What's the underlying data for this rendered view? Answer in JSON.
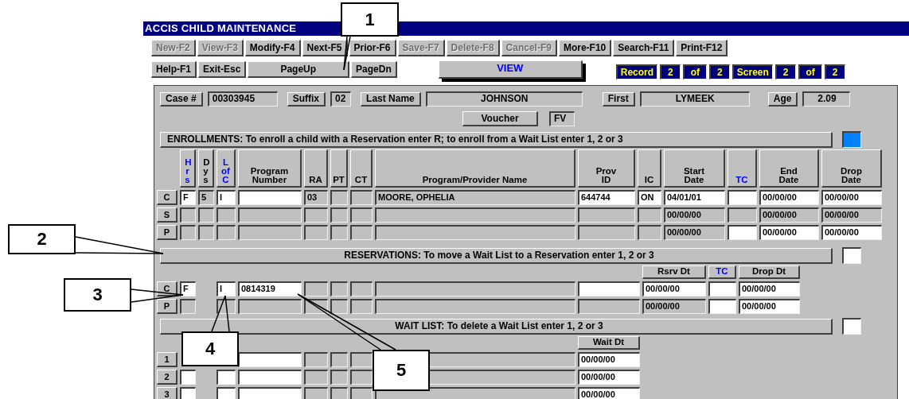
{
  "window": {
    "title": "ACCIS CHILD MAINTENANCE"
  },
  "toolbar_rows": [
    [
      {
        "label": "New-F2",
        "disabled": true
      },
      {
        "label": "View-F3",
        "disabled": true
      },
      {
        "label": "Modify-F4",
        "disabled": false
      },
      {
        "label": "Next-F5",
        "disabled": false
      },
      {
        "label": "Prior-F6",
        "disabled": false
      },
      {
        "label": "Save-F7",
        "disabled": true
      },
      {
        "label": "Delete-F8",
        "disabled": true
      },
      {
        "label": "Cancel-F9",
        "disabled": true
      },
      {
        "label": "More-F10",
        "disabled": false
      },
      {
        "label": "Search-F11",
        "disabled": false
      },
      {
        "label": "Print-F12",
        "disabled": false
      }
    ],
    [
      {
        "label": "Help-F1",
        "disabled": false
      },
      {
        "label": "Exit-Esc",
        "disabled": false
      },
      {
        "label": "PageUp",
        "disabled": false
      },
      {
        "label": "PageDn",
        "disabled": false
      }
    ]
  ],
  "mode": "VIEW",
  "pager": [
    "Record",
    "2",
    "of",
    "2",
    "Screen",
    "2",
    "of",
    "2"
  ],
  "child": {
    "fields": [
      {
        "label": "Case #",
        "value": "00303945"
      },
      {
        "label": "Suffix",
        "value": "02"
      },
      {
        "label": "Last Name",
        "value": "JOHNSON"
      },
      {
        "label": "First",
        "value": "LYMEEK"
      },
      {
        "label": "Age",
        "value": "2.09"
      }
    ],
    "voucher": {
      "label": "Voucher",
      "value": "FV"
    }
  },
  "sections": [
    {
      "kind": "enrollments",
      "title": "ENROLLMENTS: To enroll a child with a Reservation enter R;  to enroll from a Wait List enter 1, 2 or 3",
      "focused": true,
      "headers": [
        {
          "text": "Hrs",
          "kind": "vertical",
          "color": "#0000ff"
        },
        {
          "text": "Dys",
          "kind": "vertical",
          "color": "#000000"
        },
        {
          "text": "L of C",
          "kind": "stacked",
          "color": "#0000ff"
        },
        {
          "text": "Program Number",
          "kind": "stacked",
          "color": "#000000"
        },
        {
          "text": "RA",
          "kind": "stacked",
          "color": "#000000"
        },
        {
          "text": "PT",
          "kind": "stacked",
          "color": "#000000"
        },
        {
          "text": "CT",
          "kind": "stacked",
          "color": "#000000"
        },
        {
          "text": "Program/Provider Name",
          "kind": "normal",
          "color": "#000000"
        },
        {
          "text": "Prov ID",
          "kind": "stacked",
          "color": "#000000"
        },
        {
          "text": "IC",
          "kind": "stacked",
          "color": "#000000"
        },
        {
          "text": "Start Date",
          "kind": "stacked",
          "color": "#000000"
        },
        {
          "text": "TC",
          "kind": "stacked",
          "color": "#0000ff"
        },
        {
          "text": "End Date",
          "kind": "stacked",
          "color": "#000000"
        },
        {
          "text": "Drop Date",
          "kind": "stacked",
          "color": "#000000"
        }
      ],
      "rows": [
        {
          "label": "C",
          "cells": [
            {
              "value": "F",
              "editable": true
            },
            {
              "value": "5",
              "editable": false
            },
            {
              "value": "I",
              "editable": true
            },
            {
              "editable": true
            },
            {
              "value": "03",
              "editable": false
            },
            {
              "editable": false
            },
            {
              "editable": false
            },
            {
              "value": "MOORE, OPHELIA",
              "editable": false
            },
            {
              "value": "644744",
              "editable": true
            },
            {
              "value": "ON",
              "editable": true
            },
            {
              "value": "04/01/01",
              "editable": true
            },
            {
              "editable": true
            },
            {
              "value": "00/00/00",
              "editable": true
            },
            {
              "value": "00/00/00",
              "editable": true
            }
          ]
        },
        {
          "label": "S",
          "cells": [
            {
              "editable": false
            },
            {
              "editable": false
            },
            {
              "editable": false
            },
            {
              "editable": false
            },
            {
              "editable": false
            },
            {
              "editable": false
            },
            {
              "editable": false
            },
            {
              "editable": false
            },
            {
              "editable": false
            },
            {
              "editable": false
            },
            {
              "value": "00/00/00",
              "editable": false
            },
            {
              "editable": false
            },
            {
              "value": "00/00/00",
              "editable": false
            },
            {
              "value": "00/00/00",
              "editable": false
            }
          ]
        },
        {
          "label": "P",
          "cells": [
            {
              "editable": false
            },
            {
              "editable": false
            },
            {
              "editable": false
            },
            {
              "editable": false
            },
            {
              "editable": false
            },
            {
              "editable": false
            },
            {
              "editable": false
            },
            {
              "editable": false
            },
            {
              "editable": false
            },
            {
              "editable": false
            },
            {
              "value": "00/00/00",
              "editable": false
            },
            {
              "editable": true
            },
            {
              "value": "00/00/00",
              "editable": true
            },
            {
              "value": "00/00/00",
              "editable": true
            }
          ]
        }
      ]
    },
    {
      "kind": "reservations",
      "title": "RESERVATIONS: To move a Wait List to a Reservation enter 1, 2 or 3",
      "focused": false,
      "headers": [
        {
          "text": "Rsrv Dt",
          "kind": "normal",
          "color": "#000000"
        },
        {
          "text": "TC",
          "kind": "normal",
          "color": "#0000ff"
        },
        {
          "text": "Drop Dt",
          "kind": "normal",
          "color": "#000000"
        }
      ],
      "rows": [
        {
          "label": "C",
          "cells": [
            {
              "value": "F",
              "editable": true
            },
            {
              "value": "I",
              "editable": true
            },
            {
              "value": "0814319",
              "editable": true
            },
            {
              "editable": false
            },
            {
              "editable": false
            },
            {
              "editable": false
            },
            {
              "editable": false
            },
            {
              "editable": true
            },
            {
              "value": "00/00/00",
              "editable": true
            },
            {
              "editable": true
            },
            {
              "value": "00/00/00",
              "editable": true
            }
          ]
        },
        {
          "label": "P",
          "cells": [
            {
              "editable": false
            },
            {
              "editable": false
            },
            {
              "editable": false
            },
            {
              "editable": false
            },
            {
              "editable": false
            },
            {
              "editable": false
            },
            {
              "editable": false
            },
            {
              "editable": false
            },
            {
              "value": "00/00/00",
              "editable": false
            },
            {
              "editable": true
            },
            {
              "value": "00/00/00",
              "editable": true
            }
          ]
        }
      ]
    },
    {
      "kind": "wait_list",
      "title": "WAIT LIST: To delete a Wait List enter 1, 2 or 3",
      "focused": false,
      "headers": [
        {
          "text": "Wait Dt",
          "kind": "normal",
          "color": "#000000"
        }
      ],
      "rows": [
        {
          "label": "1",
          "cells": [
            {
              "kind": "covered"
            },
            {
              "kind": "covered"
            },
            {
              "editable": true
            },
            {
              "editable": false
            },
            {
              "editable": false
            },
            {
              "editable": false
            },
            {
              "editable": false
            },
            {
              "value": "00/00/00",
              "editable": true
            }
          ]
        },
        {
          "label": "2",
          "cells": [
            {
              "editable": true
            },
            {
              "editable": true
            },
            {
              "editable": true
            },
            {
              "editable": false
            },
            {
              "editable": false
            },
            {
              "editable": false
            },
            {
              "editable": false
            },
            {
              "value": "00/00/00",
              "editable": true
            }
          ]
        },
        {
          "label": "3",
          "cells": [
            {
              "editable": true
            },
            {
              "editable": true
            },
            {
              "editable": true
            },
            {
              "editable": false
            },
            {
              "editable": false
            },
            {
              "editable": false
            },
            {
              "editable": false
            },
            {
              "value": "00/00/00",
              "editable": true
            }
          ]
        }
      ]
    }
  ],
  "callouts": [
    {
      "label": "1"
    },
    {
      "label": "2"
    },
    {
      "label": "3"
    },
    {
      "label": "4"
    },
    {
      "label": "5"
    }
  ]
}
